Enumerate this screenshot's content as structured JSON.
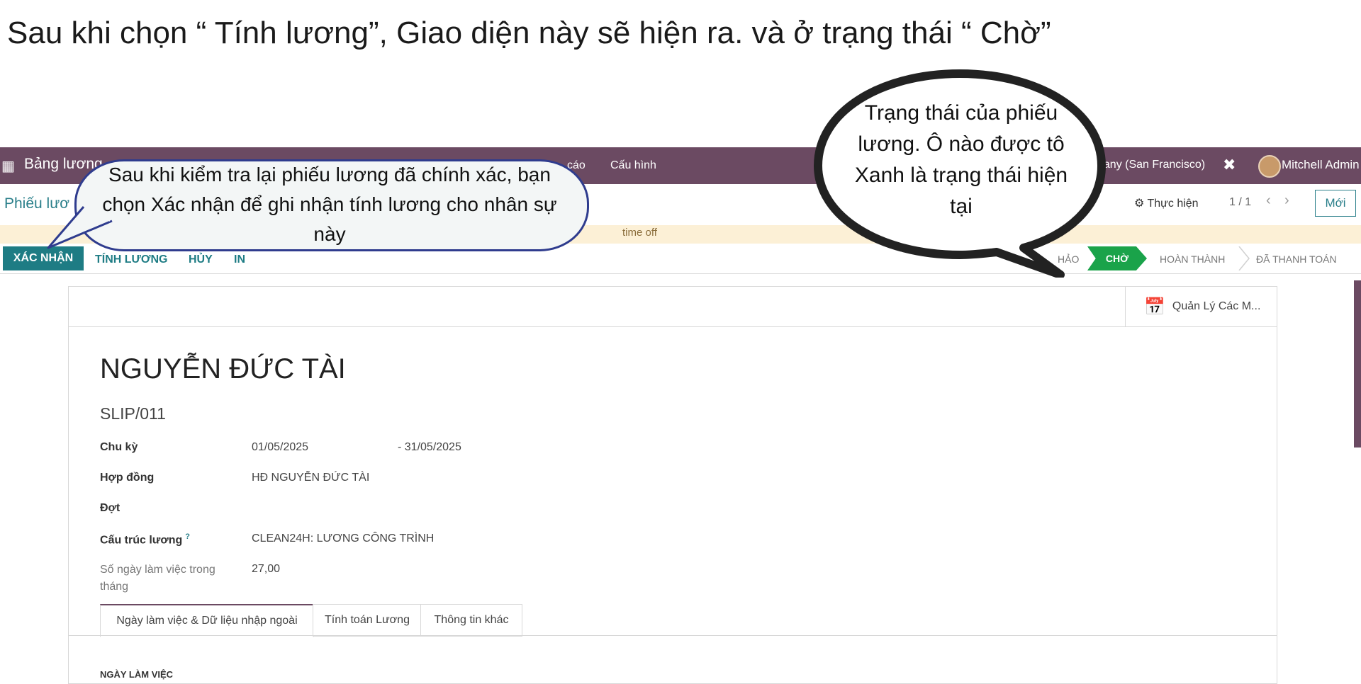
{
  "heading": "Sau khi chọn  “ Tính lương”, Giao diện này sẽ hiện ra.  và ở trạng thái “ Chờ”",
  "topbar": {
    "app_name": "Bảng lương",
    "menu_report": "cáo",
    "menu_config": "Cấu hình",
    "company": "pany (San Francisco)",
    "user": "Mitchell Admin"
  },
  "control": {
    "breadcrumb": "Phiếu lươ",
    "actions_label": "Thực hiện",
    "pager": "1 / 1",
    "new_label": "Mới"
  },
  "warning": {
    "text": "time off"
  },
  "status": {
    "buttons": [
      "XÁC NHẬN",
      "TÍNH LƯƠNG",
      "HỦY",
      "IN"
    ],
    "stage_draft": "HẢO",
    "stage_active": "CHỜ",
    "stage_done": "HOÀN THÀNH",
    "stage_paid": "ĐÃ THANH TOÁN"
  },
  "sheet": {
    "smart_button": "Quản Lý Các M...",
    "employee_name": "NGUYỄN ĐỨC TÀI",
    "slip_ref": "SLIP/011",
    "fields": {
      "period_label": "Chu kỳ",
      "period_from": "01/05/2025",
      "period_to": "- 31/05/2025",
      "contract_label": "Hợp đồng",
      "contract_value": "HĐ NGUYỄN ĐỨC TÀI",
      "batch_label": "Đợt",
      "structure_label": "Cấu trúc lương",
      "structure_help": "?",
      "structure_value": "CLEAN24H: LƯƠNG CÔNG TRÌNH",
      "workdays_label": "Số ngày làm việc trong tháng",
      "workdays_value": "27,00"
    },
    "tabs": [
      "Ngày làm việc & Dữ liệu nhập ngoài",
      "Tính toán Lương",
      "Thông tin khác"
    ],
    "section_title": "NGÀY LÀM VIỆC"
  },
  "callouts": {
    "left": "Sau khi kiểm tra lại phiếu lương đã chính xác, bạn chọn Xác nhận để ghi nhận tính lương cho nhân sự này",
    "right": "Trạng thái  của phiếu lương. Ô nào được tô Xanh là trạng thái hiện tại"
  },
  "colors": {
    "topbar": "#6b4a62",
    "primary": "#1e7c84",
    "stage_active": "#1aa34a",
    "warning_bg": "#fcf0d6"
  }
}
